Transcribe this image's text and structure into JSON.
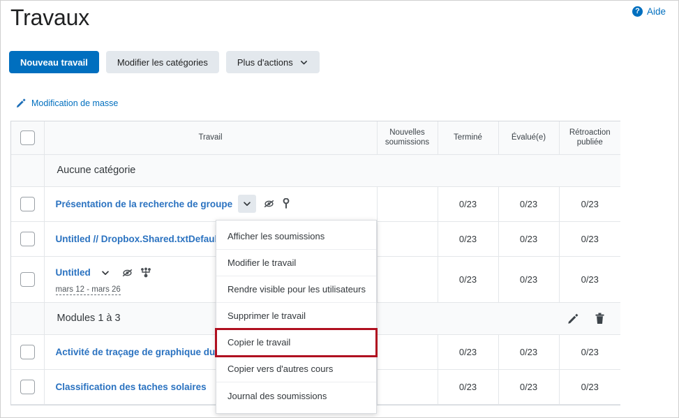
{
  "header": {
    "title": "Travaux",
    "help_label": "Aide",
    "help_icon": "question-circle-icon"
  },
  "toolbar": {
    "new_assignment_label": "Nouveau travail",
    "edit_categories_label": "Modifier les catégories",
    "more_actions_label": "Plus d'actions"
  },
  "bulk_edit": {
    "label": "Modification de masse",
    "icon": "pencil-edit-icon"
  },
  "table": {
    "columns": [
      "Travail",
      "Nouvelles soumissions",
      "Terminé",
      "Évalué(e)",
      "Rétroaction publiée"
    ],
    "categories": [
      {
        "name": "Aucune catégorie",
        "has_actions": false,
        "rows": [
          {
            "title": "Présentation de la recherche de groupe",
            "has_chevron": true,
            "chevron_active": true,
            "icons": [
              "eye-hidden-icon",
              "key-icon"
            ],
            "due_date": null,
            "new_submissions": "",
            "completed": "0/23",
            "evaluated": "0/23",
            "feedback_published": "0/23"
          },
          {
            "title": "Untitled // Dropbox.Shared.txtDefaultN",
            "has_chevron": false,
            "chevron_active": false,
            "icons": [],
            "due_date": null,
            "new_submissions": "",
            "completed": "0/23",
            "evaluated": "0/23",
            "feedback_published": "0/23"
          },
          {
            "title": "Untitled",
            "has_chevron": true,
            "chevron_active": false,
            "icons": [
              "eye-hidden-icon",
              "group-icon"
            ],
            "due_date": "mars 12 - mars 26",
            "new_submissions": "",
            "completed": "0/23",
            "evaluated": "0/23",
            "feedback_published": "0/23"
          }
        ]
      },
      {
        "name": "Modules 1 à 3",
        "has_actions": true,
        "edit_icon": "pencil-icon",
        "delete_icon": "trash-icon",
        "rows": [
          {
            "title": "Activité de traçage de graphique du cycl",
            "has_chevron": false,
            "chevron_active": false,
            "icons": [],
            "due_date": null,
            "new_submissions": "",
            "completed": "0/23",
            "evaluated": "0/23",
            "feedback_published": "0/23"
          },
          {
            "title": "Classification des taches solaires",
            "has_chevron": true,
            "chevron_active": false,
            "icons": [],
            "due_date": null,
            "new_submissions": "",
            "completed": "0/23",
            "evaluated": "0/23",
            "feedback_published": "0/23"
          }
        ]
      }
    ]
  },
  "context_menu": {
    "items": [
      {
        "label": "Afficher les soumissions",
        "highlighted": false
      },
      {
        "label": "Modifier le travail",
        "highlighted": false
      },
      {
        "label": "Rendre visible pour les utilisateurs",
        "highlighted": false
      },
      {
        "label": "Supprimer le travail",
        "highlighted": false
      },
      {
        "label": "Copier le travail",
        "highlighted": true
      },
      {
        "label": "Copier vers d'autres cours",
        "highlighted": false
      },
      {
        "label": "Journal des soumissions",
        "highlighted": false
      }
    ]
  },
  "colors": {
    "primary_blue": "#006fbf",
    "link_blue": "#2a72c0",
    "highlight_red": "#b01020",
    "secondary_button": "#e3e8ed"
  }
}
